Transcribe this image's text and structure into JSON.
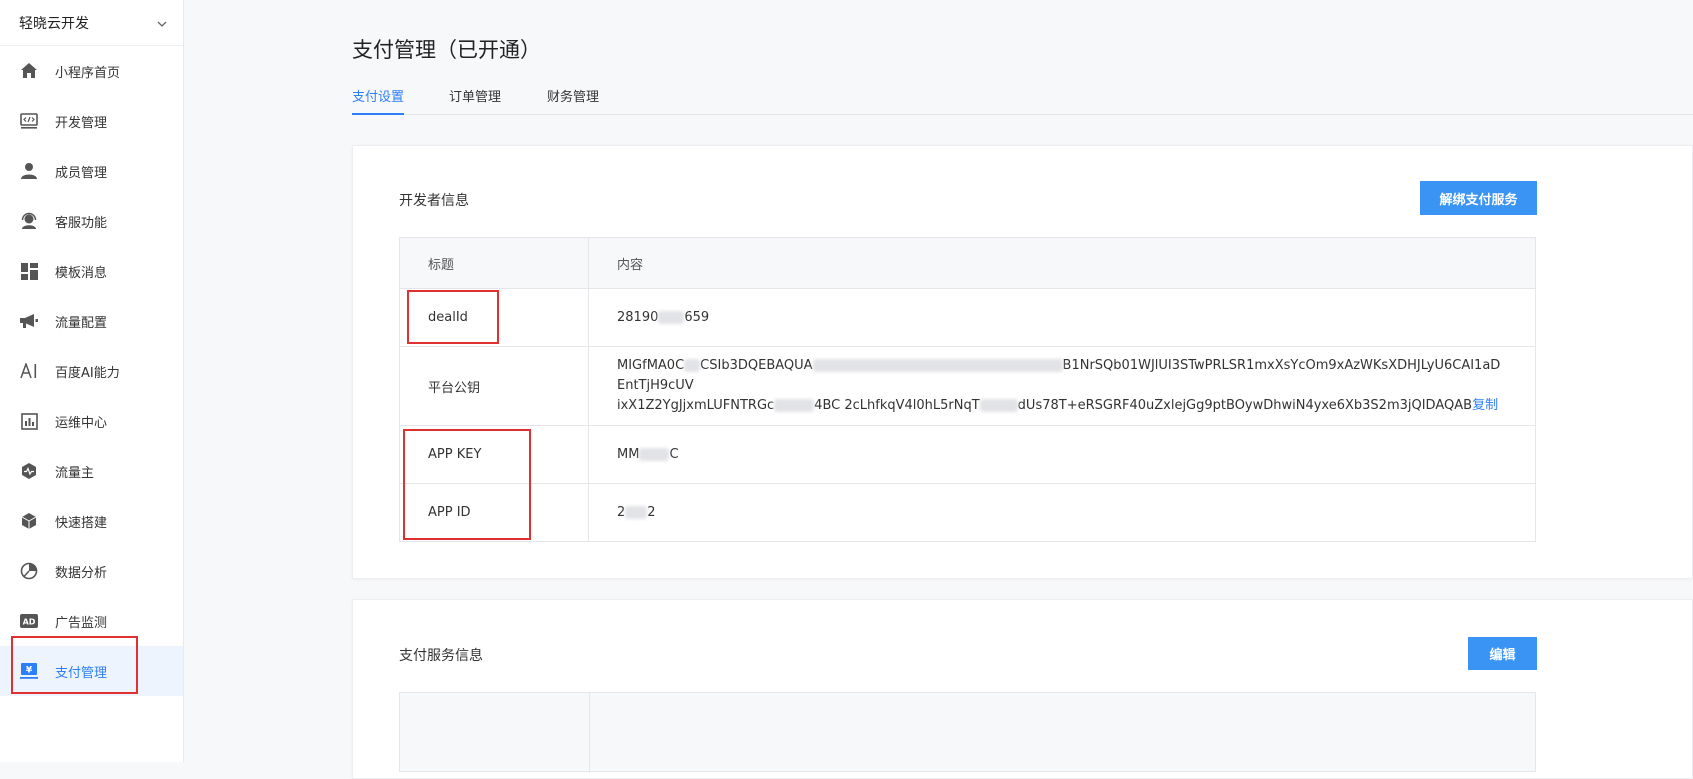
{
  "sidebar": {
    "app_name": "轻晓云开发",
    "items": [
      {
        "label": "小程序首页",
        "icon": "home-icon"
      },
      {
        "label": "开发管理",
        "icon": "code-icon"
      },
      {
        "label": "成员管理",
        "icon": "person-icon"
      },
      {
        "label": "客服功能",
        "icon": "headset-icon"
      },
      {
        "label": "模板消息",
        "icon": "grid-icon"
      },
      {
        "label": "流量配置",
        "icon": "megaphone-icon"
      },
      {
        "label": "百度AI能力",
        "icon": "ai-icon"
      },
      {
        "label": "运维中心",
        "icon": "bar-chart-icon"
      },
      {
        "label": "流量主",
        "icon": "pulse-icon"
      },
      {
        "label": "快速搭建",
        "icon": "cube-icon"
      },
      {
        "label": "数据分析",
        "icon": "pie-chart-icon"
      },
      {
        "label": "广告监测",
        "icon": "ad-icon"
      },
      {
        "label": "支付管理",
        "icon": "payment-icon",
        "active": true
      }
    ]
  },
  "page": {
    "title": "支付管理（已开通）",
    "tabs": [
      "支付设置",
      "订单管理",
      "财务管理"
    ],
    "active_tab": 0
  },
  "developer_card": {
    "title": "开发者信息",
    "unbind_button": "解绑支付服务",
    "table": {
      "headers": [
        "标题",
        "内容"
      ],
      "rows": [
        {
          "key": "dealId",
          "value_prefix": "28190",
          "value_suffix": "659"
        },
        {
          "key": "平台公钥",
          "line1_prefix": "MIGfMA0C",
          "line1_mid": "CSIb3DQEBAQUA",
          "line1_suffix": "B1NrSQb01WJlUI3STwPRLSR1mxXsYcOm9xAzWKsXDHJLyU6CAI1aDEntTjH9cUV",
          "line2_prefix": "ixX1Z2YgJjxmLUFNTRGc",
          "line2_mid": "4BC  2cLhfkqV4l0hL5rNqT",
          "line2_suffix": "dUs78T+eRSGRF40uZxlejGg9ptBOywDhwiN4yxe6Xb3S2m3jQIDAQAB",
          "copy_label": "复制"
        },
        {
          "key": "APP KEY",
          "value_prefix": "MM",
          "value_suffix": "C"
        },
        {
          "key": "APP ID",
          "value_prefix": "2",
          "value_suffix": "2"
        }
      ]
    }
  },
  "payment_card": {
    "title": "支付服务信息",
    "edit_button": "编辑"
  },
  "colors": {
    "accent": "#2d7ff9",
    "button": "#3a94f4",
    "highlight": "#e03131"
  }
}
